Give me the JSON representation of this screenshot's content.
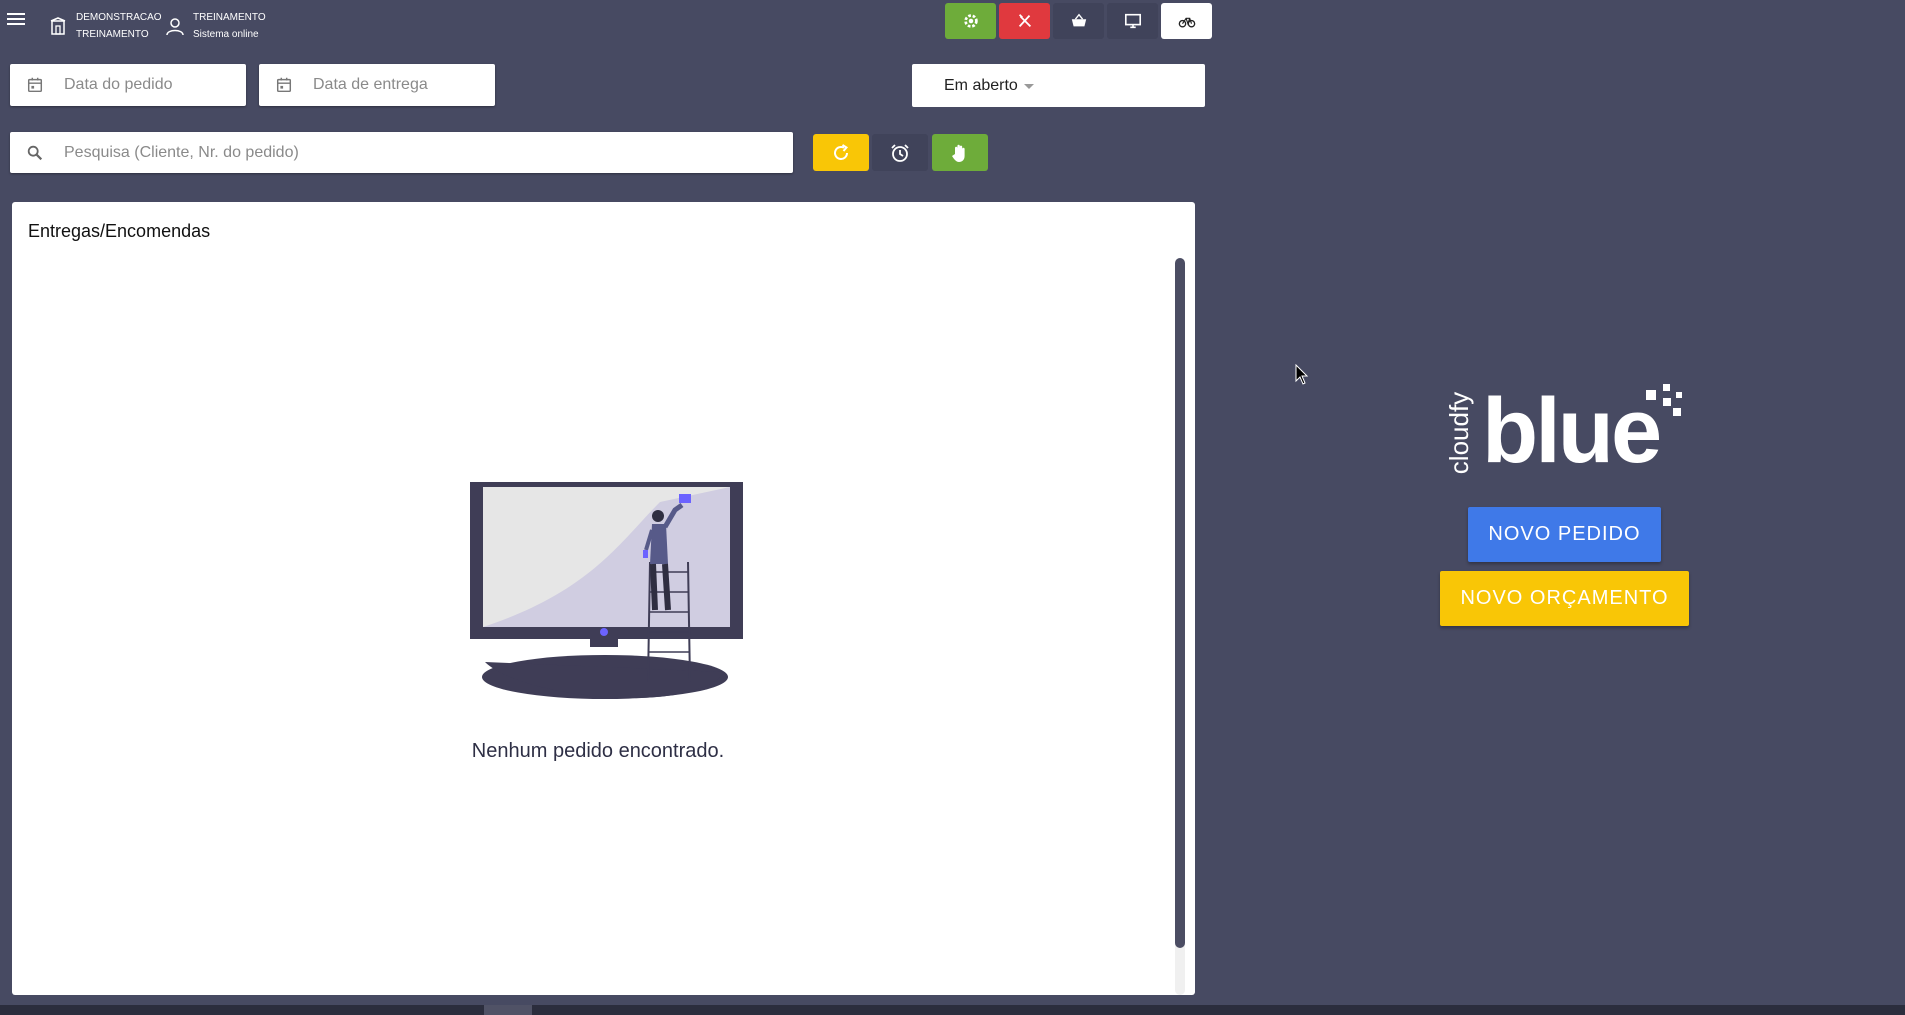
{
  "header": {
    "store_line1": "DEMONSTRACAO",
    "store_line2": "TREINAMENTO",
    "user_line1": "TREINAMENTO",
    "user_line2": "Sistema online",
    "icons": [
      "settings-icon",
      "restaurant-icon",
      "basket-icon",
      "monitor-icon",
      "bicycle-icon"
    ]
  },
  "filters": {
    "order_date_placeholder": "Data do pedido",
    "delivery_date_placeholder": "Data de entrega",
    "status_value": "Em aberto",
    "search_placeholder": "Pesquisa (Cliente, Nr. do pedido)"
  },
  "panel": {
    "title": "Entregas/Encomendas",
    "empty_message": "Nenhum pedido encontrado."
  },
  "brand": {
    "small": "cloudfy",
    "word": "blue"
  },
  "actions": {
    "new_order": "NOVO PEDIDO",
    "new_quote": "NOVO ORÇAMENTO"
  },
  "colors": {
    "background": "#474a62",
    "green": "#6eac3a",
    "red": "#e0393e",
    "yellow": "#f9c606",
    "blue": "#3f79e8",
    "illustration_accent": "#6c63ff"
  }
}
